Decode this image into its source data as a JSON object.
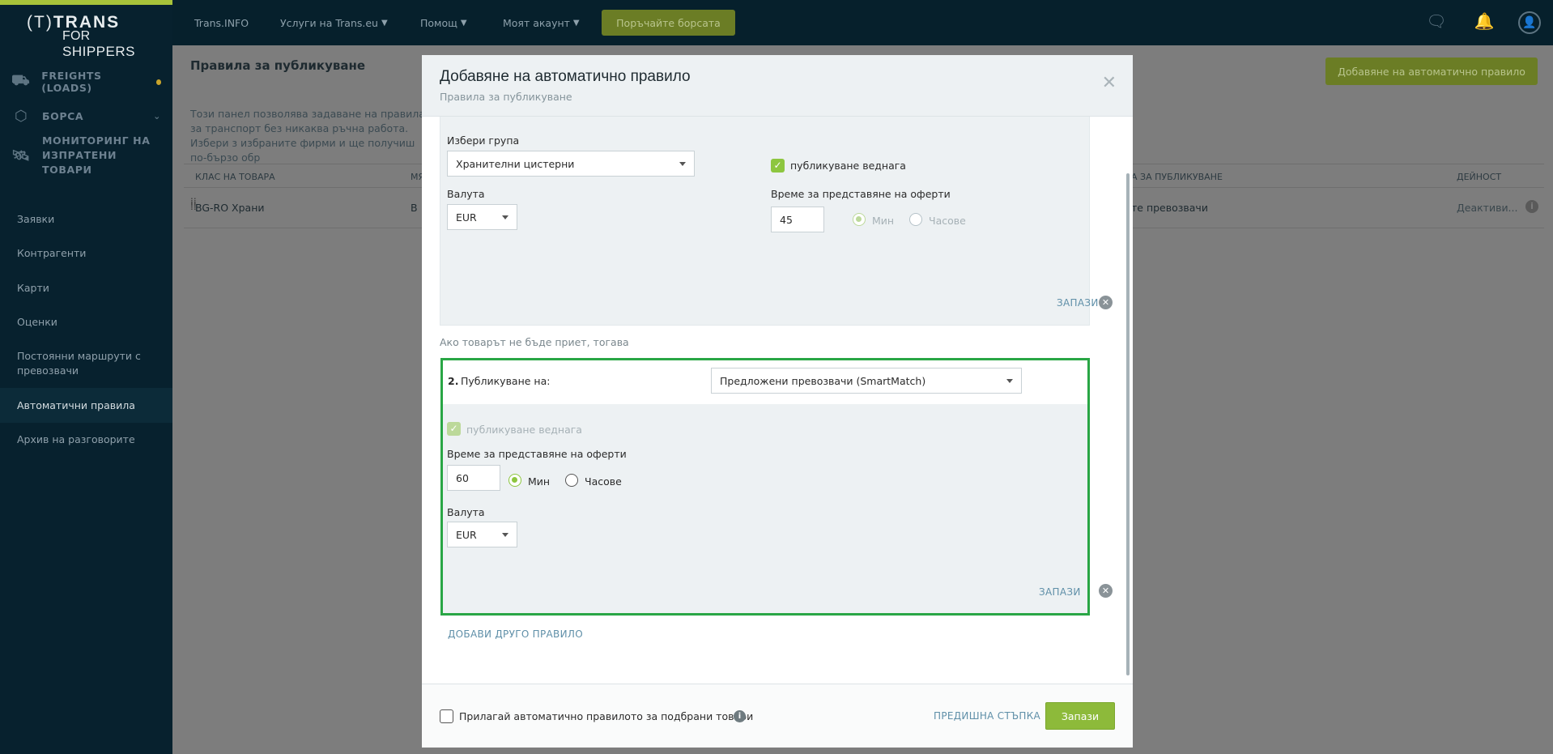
{
  "logo": {
    "line1_paren": "(T)",
    "line1": "TRANS",
    "line2_for": "FOR",
    "line2_brand": "SHIPPERS"
  },
  "sidebar": {
    "main": [
      {
        "label": "FREIGHTS (LOADS)",
        "icon": "freights-icon"
      },
      {
        "label": "БОРСА",
        "icon": "cube-icon"
      },
      {
        "label": "МОНИТОРИНГ НА ИЗПРАТЕНИ ТОВАРИ",
        "icon": "satellite-icon"
      }
    ],
    "sub": [
      {
        "label": "Заявки"
      },
      {
        "label": "Контрагенти"
      },
      {
        "label": "Карти"
      },
      {
        "label": "Оценки"
      },
      {
        "label": "Постоянни маршрути с превозвачи"
      },
      {
        "label": "Автоматични правила"
      },
      {
        "label": "Архив на разговорите"
      }
    ]
  },
  "topbar": {
    "nav": [
      "Trans.INFO",
      "Услуги на Trans.eu",
      "Помощ",
      "Моят акаунт"
    ],
    "order_button": "Поръчайте борсата",
    "icons": [
      "chat-icon",
      "bell-icon",
      "user-avatar-icon"
    ]
  },
  "page": {
    "title": "Правила за публикуване",
    "description": "Този панел позволява задаване на правила за транспорт без никаква ръчна работа. Избери з избраните фирми и ще получиш по-бързо обр",
    "add_button": "Добавяне на автоматично правило",
    "columns": [
      "КЛАС НА ТОВАРА",
      "МЯ",
      "А ЗА ПУБЛИКУВАНЕ",
      "ДЕЙНОСТ"
    ],
    "row": {
      "name": "BG-RO Храни",
      "col2": "В",
      "col3": "те превозвачи",
      "action": "Деактиви..."
    }
  },
  "modal": {
    "title": "Добавяне на автоматично правило",
    "subtitle": "Правила за публикуване",
    "rule1": {
      "group_label": "Избери група",
      "group_value": "Хранителни цистерни",
      "currency_label": "Валута",
      "currency_value": "EUR",
      "publish_now_label": "публикуване веднага",
      "publish_now_checked": true,
      "offer_time_label": "Време за представяне на оферти",
      "offer_time_value": "45",
      "unit_min": "Мин",
      "unit_hours": "Часове",
      "selected_unit": "Мин",
      "save_link": "ЗАПАЗИ"
    },
    "separator_text": "Ако товарът не бъде приет, тогава",
    "rule2": {
      "number": "2.",
      "publish_on_label": "Публикуване на:",
      "publish_on_value": "Предложени превозвачи (SmartMatch)",
      "publish_now_label": "публикуване веднага",
      "publish_now_checked": true,
      "offer_time_label": "Време за представяне на оферти",
      "offer_time_value": "60",
      "unit_min": "Мин",
      "unit_hours": "Часове",
      "selected_unit": "Мин",
      "currency_label": "Валута",
      "currency_value": "EUR",
      "save_link": "ЗАПАЗИ"
    },
    "add_rule_link": "ДОБАВИ ДРУГО ПРАВИЛО",
    "footer": {
      "apply_label": "Прилагай автоматично правилото за подбрани товари",
      "apply_checked": false,
      "prev_step": "ПРЕДИШНА СТЪПКА",
      "save": "Запази"
    }
  },
  "colors": {
    "accent_green": "#8dba3a",
    "highlight_border": "#29a645",
    "sidebar_bg": "#07212e",
    "link": "#5f8fa8"
  }
}
